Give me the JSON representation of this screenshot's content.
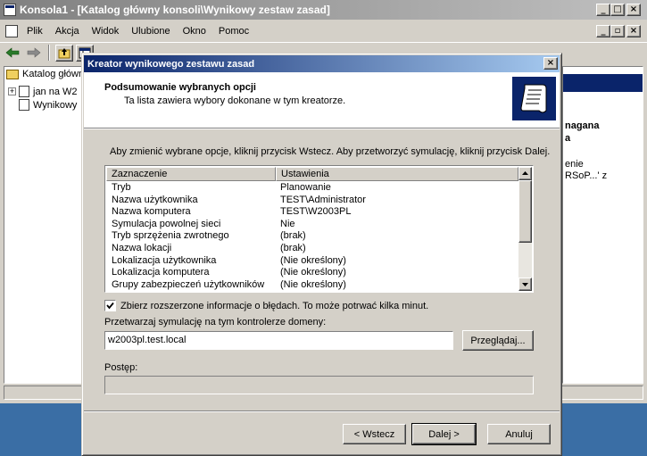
{
  "mmc": {
    "title": "Konsola1 - [Katalog główny konsoli\\Wynikowy zestaw zasad]",
    "menu": [
      "Plik",
      "Akcja",
      "Widok",
      "Ulubione",
      "Okno",
      "Pomoc"
    ],
    "tree": {
      "root": "Katalog główny",
      "items": [
        "jan na W2",
        "Wynikowy"
      ]
    },
    "right_fragments": [
      "nagana",
      "a",
      "enie",
      "RSoP...' z"
    ]
  },
  "wizard": {
    "title": "Kreator wynikowego zestawu zasad",
    "header_title": "Podsumowanie wybranych opcji",
    "header_subtitle": "Ta lista zawiera wybory dokonane w tym kreatorze.",
    "instructions": "Aby zmienić wybrane opcje, kliknij przycisk Wstecz. Aby przetworzyć symulację, kliknij przycisk Dalej.",
    "list": {
      "col1": "Zaznaczenie",
      "col2": "Ustawienia",
      "rows": [
        [
          "Tryb",
          "Planowanie"
        ],
        [
          "Nazwa użytkownika",
          "TEST\\Administrator"
        ],
        [
          "Nazwa komputera",
          "TEST\\W2003PL"
        ],
        [
          "Symulacja powolnej sieci",
          "Nie"
        ],
        [
          "Tryb sprzężenia zwrotnego",
          "(brak)"
        ],
        [
          "Nazwa lokacji",
          "(brak)"
        ],
        [
          "Lokalizacja użytkownika",
          "(Nie określony)"
        ],
        [
          "Lokalizacja komputera",
          "(Nie określony)"
        ],
        [
          "Grupy zabezpieczeń użytkowników",
          "(Nie określony)"
        ]
      ]
    },
    "checkbox_label": "Zbierz rozszerzone informacje o błędach. To może potrwać kilka minut.",
    "checkbox_checked": true,
    "dc_label": "Przetwarzaj symulację na tym kontrolerze domeny:",
    "dc_value": "w2003pl.test.local",
    "browse_label": "Przeglądaj...",
    "progress_label": "Postęp:",
    "progress": 0,
    "buttons": {
      "back": "< Wstecz",
      "next": "Dalej >",
      "cancel": "Anuluj"
    }
  }
}
